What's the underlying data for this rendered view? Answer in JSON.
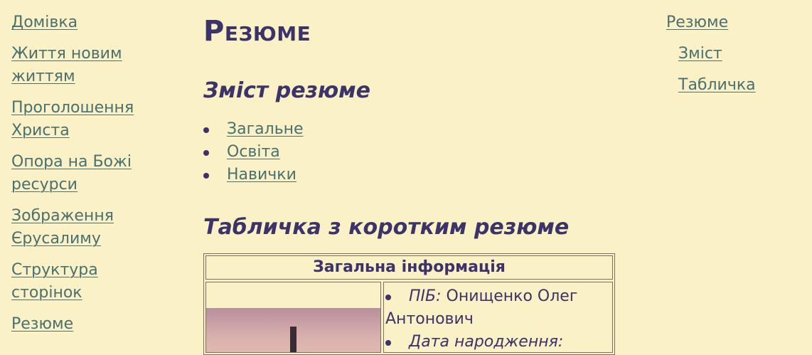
{
  "left_nav": {
    "items": [
      {
        "label": "Домівка"
      },
      {
        "label": "Життя новим життям"
      },
      {
        "label": "Проголошення Христа"
      },
      {
        "label": "Опора на Божі ресурси"
      },
      {
        "label": "Зображення Єрусалиму"
      },
      {
        "label": "Структура сторінок"
      },
      {
        "label": "Резюме"
      }
    ]
  },
  "main": {
    "title": "Резюме",
    "toc_heading": "Зміст резюме",
    "toc_items": [
      {
        "label": "Загальне"
      },
      {
        "label": "Освіта"
      },
      {
        "label": "Навички"
      }
    ],
    "table_heading": "Табличка з коротким резюме",
    "table": {
      "header": "Загальна інформація",
      "items": [
        {
          "label": "ПІБ:",
          "value": " Онищенко Олег Антонович"
        },
        {
          "label": "Дата народження:",
          "value": ""
        }
      ]
    }
  },
  "right_nav": {
    "items": [
      {
        "label": "Резюме",
        "level": 1
      },
      {
        "label": "Зміст",
        "level": 2
      },
      {
        "label": "Табличка",
        "level": 2
      }
    ]
  },
  "colors": {
    "background": "#faf1c6",
    "text": "#3c3369",
    "link": "#4a7070"
  }
}
